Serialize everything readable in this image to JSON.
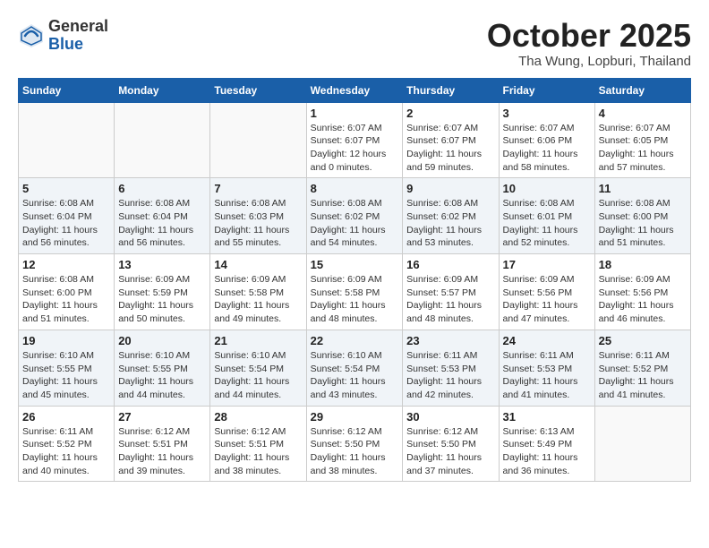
{
  "header": {
    "logo_general": "General",
    "logo_blue": "Blue",
    "month_title": "October 2025",
    "location": "Tha Wung, Lopburi, Thailand"
  },
  "weekdays": [
    "Sunday",
    "Monday",
    "Tuesday",
    "Wednesday",
    "Thursday",
    "Friday",
    "Saturday"
  ],
  "weeks": [
    [
      {
        "day": "",
        "info": ""
      },
      {
        "day": "",
        "info": ""
      },
      {
        "day": "",
        "info": ""
      },
      {
        "day": "1",
        "info": "Sunrise: 6:07 AM\nSunset: 6:07 PM\nDaylight: 12 hours\nand 0 minutes."
      },
      {
        "day": "2",
        "info": "Sunrise: 6:07 AM\nSunset: 6:07 PM\nDaylight: 11 hours\nand 59 minutes."
      },
      {
        "day": "3",
        "info": "Sunrise: 6:07 AM\nSunset: 6:06 PM\nDaylight: 11 hours\nand 58 minutes."
      },
      {
        "day": "4",
        "info": "Sunrise: 6:07 AM\nSunset: 6:05 PM\nDaylight: 11 hours\nand 57 minutes."
      }
    ],
    [
      {
        "day": "5",
        "info": "Sunrise: 6:08 AM\nSunset: 6:04 PM\nDaylight: 11 hours\nand 56 minutes."
      },
      {
        "day": "6",
        "info": "Sunrise: 6:08 AM\nSunset: 6:04 PM\nDaylight: 11 hours\nand 56 minutes."
      },
      {
        "day": "7",
        "info": "Sunrise: 6:08 AM\nSunset: 6:03 PM\nDaylight: 11 hours\nand 55 minutes."
      },
      {
        "day": "8",
        "info": "Sunrise: 6:08 AM\nSunset: 6:02 PM\nDaylight: 11 hours\nand 54 minutes."
      },
      {
        "day": "9",
        "info": "Sunrise: 6:08 AM\nSunset: 6:02 PM\nDaylight: 11 hours\nand 53 minutes."
      },
      {
        "day": "10",
        "info": "Sunrise: 6:08 AM\nSunset: 6:01 PM\nDaylight: 11 hours\nand 52 minutes."
      },
      {
        "day": "11",
        "info": "Sunrise: 6:08 AM\nSunset: 6:00 PM\nDaylight: 11 hours\nand 51 minutes."
      }
    ],
    [
      {
        "day": "12",
        "info": "Sunrise: 6:08 AM\nSunset: 6:00 PM\nDaylight: 11 hours\nand 51 minutes."
      },
      {
        "day": "13",
        "info": "Sunrise: 6:09 AM\nSunset: 5:59 PM\nDaylight: 11 hours\nand 50 minutes."
      },
      {
        "day": "14",
        "info": "Sunrise: 6:09 AM\nSunset: 5:58 PM\nDaylight: 11 hours\nand 49 minutes."
      },
      {
        "day": "15",
        "info": "Sunrise: 6:09 AM\nSunset: 5:58 PM\nDaylight: 11 hours\nand 48 minutes."
      },
      {
        "day": "16",
        "info": "Sunrise: 6:09 AM\nSunset: 5:57 PM\nDaylight: 11 hours\nand 48 minutes."
      },
      {
        "day": "17",
        "info": "Sunrise: 6:09 AM\nSunset: 5:56 PM\nDaylight: 11 hours\nand 47 minutes."
      },
      {
        "day": "18",
        "info": "Sunrise: 6:09 AM\nSunset: 5:56 PM\nDaylight: 11 hours\nand 46 minutes."
      }
    ],
    [
      {
        "day": "19",
        "info": "Sunrise: 6:10 AM\nSunset: 5:55 PM\nDaylight: 11 hours\nand 45 minutes."
      },
      {
        "day": "20",
        "info": "Sunrise: 6:10 AM\nSunset: 5:55 PM\nDaylight: 11 hours\nand 44 minutes."
      },
      {
        "day": "21",
        "info": "Sunrise: 6:10 AM\nSunset: 5:54 PM\nDaylight: 11 hours\nand 44 minutes."
      },
      {
        "day": "22",
        "info": "Sunrise: 6:10 AM\nSunset: 5:54 PM\nDaylight: 11 hours\nand 43 minutes."
      },
      {
        "day": "23",
        "info": "Sunrise: 6:11 AM\nSunset: 5:53 PM\nDaylight: 11 hours\nand 42 minutes."
      },
      {
        "day": "24",
        "info": "Sunrise: 6:11 AM\nSunset: 5:53 PM\nDaylight: 11 hours\nand 41 minutes."
      },
      {
        "day": "25",
        "info": "Sunrise: 6:11 AM\nSunset: 5:52 PM\nDaylight: 11 hours\nand 41 minutes."
      }
    ],
    [
      {
        "day": "26",
        "info": "Sunrise: 6:11 AM\nSunset: 5:52 PM\nDaylight: 11 hours\nand 40 minutes."
      },
      {
        "day": "27",
        "info": "Sunrise: 6:12 AM\nSunset: 5:51 PM\nDaylight: 11 hours\nand 39 minutes."
      },
      {
        "day": "28",
        "info": "Sunrise: 6:12 AM\nSunset: 5:51 PM\nDaylight: 11 hours\nand 38 minutes."
      },
      {
        "day": "29",
        "info": "Sunrise: 6:12 AM\nSunset: 5:50 PM\nDaylight: 11 hours\nand 38 minutes."
      },
      {
        "day": "30",
        "info": "Sunrise: 6:12 AM\nSunset: 5:50 PM\nDaylight: 11 hours\nand 37 minutes."
      },
      {
        "day": "31",
        "info": "Sunrise: 6:13 AM\nSunset: 5:49 PM\nDaylight: 11 hours\nand 36 minutes."
      },
      {
        "day": "",
        "info": ""
      }
    ]
  ]
}
